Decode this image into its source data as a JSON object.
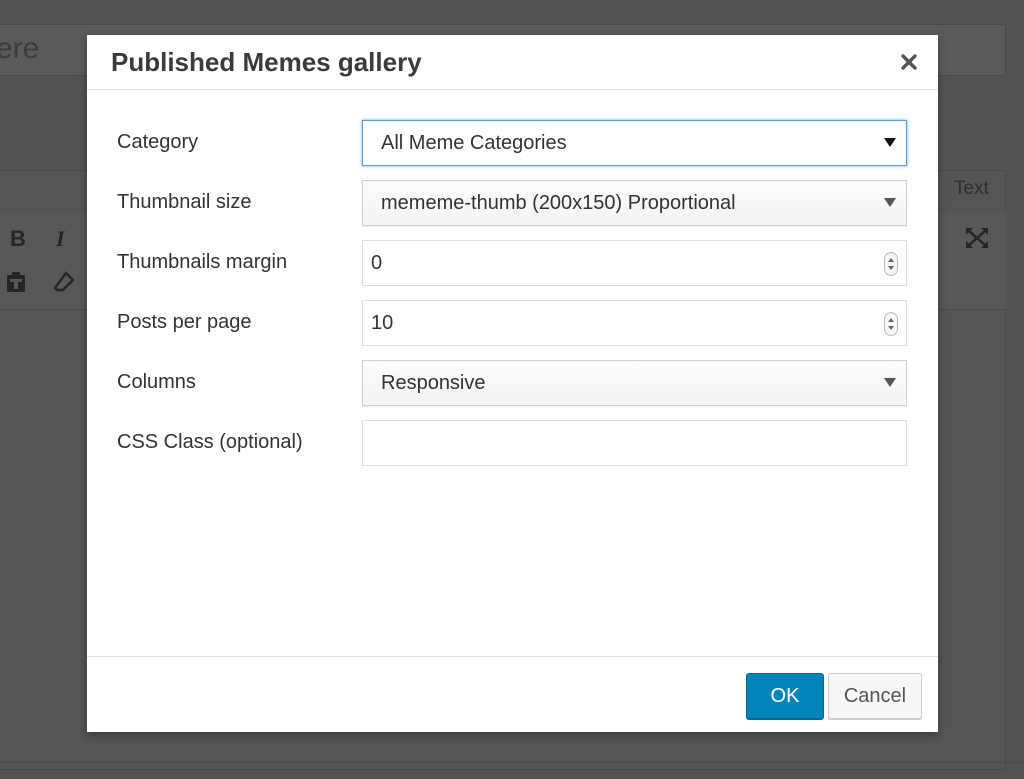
{
  "background": {
    "title_partial": "ere",
    "tab_text": "Text",
    "toolbar": {
      "bold_label": "B",
      "italic_label": "I",
      "icons": [
        "paste-text-icon",
        "eraser-icon",
        "fullscreen-icon"
      ]
    }
  },
  "modal": {
    "title": "Published Memes gallery",
    "close_icon": "close-icon",
    "fields": {
      "category": {
        "label": "Category",
        "value": "All Meme Categories"
      },
      "thumbnail_size": {
        "label": "Thumbnail size",
        "value": "mememe-thumb (200x150) Proportional"
      },
      "thumbnails_margin": {
        "label": "Thumbnails margin",
        "value": "0"
      },
      "posts_per_page": {
        "label": "Posts per page",
        "value": "10"
      },
      "columns": {
        "label": "Columns",
        "value": "Responsive"
      },
      "css_class": {
        "label": "CSS Class (optional)",
        "value": ""
      }
    },
    "buttons": {
      "ok": "OK",
      "cancel": "Cancel"
    }
  },
  "colors": {
    "primary_button": "#0085ba",
    "overlay": "#535353",
    "focus_ring": "#5b9dd9"
  }
}
